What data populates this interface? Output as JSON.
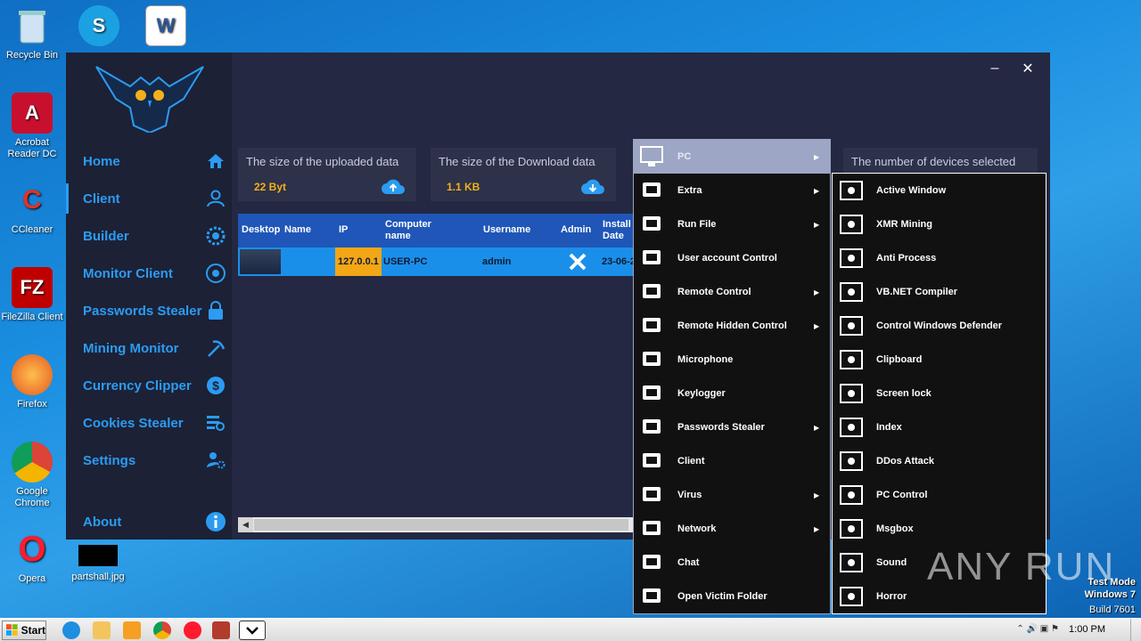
{
  "desktop_icons": [
    {
      "label": "Recycle Bin",
      "icon": "recycle-bin-icon"
    },
    {
      "label": "",
      "icon": "skype-icon"
    },
    {
      "label": "",
      "icon": "word-icon"
    },
    {
      "label": "Acrobat Reader DC",
      "icon": "acrobat-icon"
    },
    {
      "label": "CCleaner",
      "icon": "ccleaner-icon"
    },
    {
      "label": "FileZilla Client",
      "icon": "filezilla-icon"
    },
    {
      "label": "Firefox",
      "icon": "firefox-icon"
    },
    {
      "label": "Google Chrome",
      "icon": "chrome-icon"
    },
    {
      "label": "Opera",
      "icon": "opera-icon"
    },
    {
      "label": "partshall.jpg",
      "icon": "image-file-icon"
    }
  ],
  "window": {
    "minimize": "–",
    "close": "✕"
  },
  "sidebar": {
    "items": [
      {
        "label": "Home",
        "icon": "home-icon"
      },
      {
        "label": "Client",
        "icon": "user-icon"
      },
      {
        "label": "Builder",
        "icon": "gear-icon"
      },
      {
        "label": "Monitor Client",
        "icon": "eye-icon"
      },
      {
        "label": "Passwords Stealer",
        "icon": "lock-icon"
      },
      {
        "label": "Mining Monitor",
        "icon": "pickaxe-icon"
      },
      {
        "label": "Currency Clipper",
        "icon": "currency-icon"
      },
      {
        "label": "Cookies Stealer",
        "icon": "list-search-icon"
      },
      {
        "label": "Settings",
        "icon": "user-settings-icon"
      }
    ],
    "about": "About"
  },
  "stats": {
    "uploaded": {
      "title": "The size of the uploaded data",
      "value": "22 Byt"
    },
    "downloaded": {
      "title": "The size of the Download data",
      "value": "1.1 KB"
    },
    "devices": {
      "title": "The number of devices selected"
    }
  },
  "grid": {
    "columns": [
      "Desktop",
      "Name",
      "IP",
      "Computer name",
      "Username",
      "Admin",
      "Install Date"
    ],
    "row": {
      "ip": "127.0.0.1",
      "computer": "USER-PC",
      "username": "admin",
      "install": "23-06-2"
    }
  },
  "menu": {
    "items": [
      {
        "label": "PC",
        "has_sub": true
      },
      {
        "label": "Extra",
        "has_sub": true
      },
      {
        "label": "Run File",
        "has_sub": true
      },
      {
        "label": "User account Control",
        "has_sub": false
      },
      {
        "label": "Remote Control",
        "has_sub": true
      },
      {
        "label": "Remote Hidden Control",
        "has_sub": true
      },
      {
        "label": "Microphone",
        "has_sub": false
      },
      {
        "label": "Keylogger",
        "has_sub": false
      },
      {
        "label": "Passwords Stealer",
        "has_sub": true
      },
      {
        "label": "Client",
        "has_sub": false
      },
      {
        "label": "Virus",
        "has_sub": true
      },
      {
        "label": "Network",
        "has_sub": true
      },
      {
        "label": "Chat",
        "has_sub": false
      },
      {
        "label": "Open Victim Folder",
        "has_sub": false
      }
    ]
  },
  "submenu": {
    "items": [
      "Active Window",
      "XMR Mining",
      "Anti Process",
      "VB.NET Compiler",
      "Control Windows Defender",
      "Clipboard",
      "Screen lock",
      "Index",
      "DDos Attack",
      "PC Control",
      "Msgbox",
      "Sound",
      "Horror"
    ]
  },
  "taskbar": {
    "start": "Start",
    "time": "1:00 PM"
  },
  "watermark": {
    "brand": "ANY RUN",
    "line1": "Test Mode",
    "line2": "Windows 7",
    "line3": "Build 7601"
  }
}
